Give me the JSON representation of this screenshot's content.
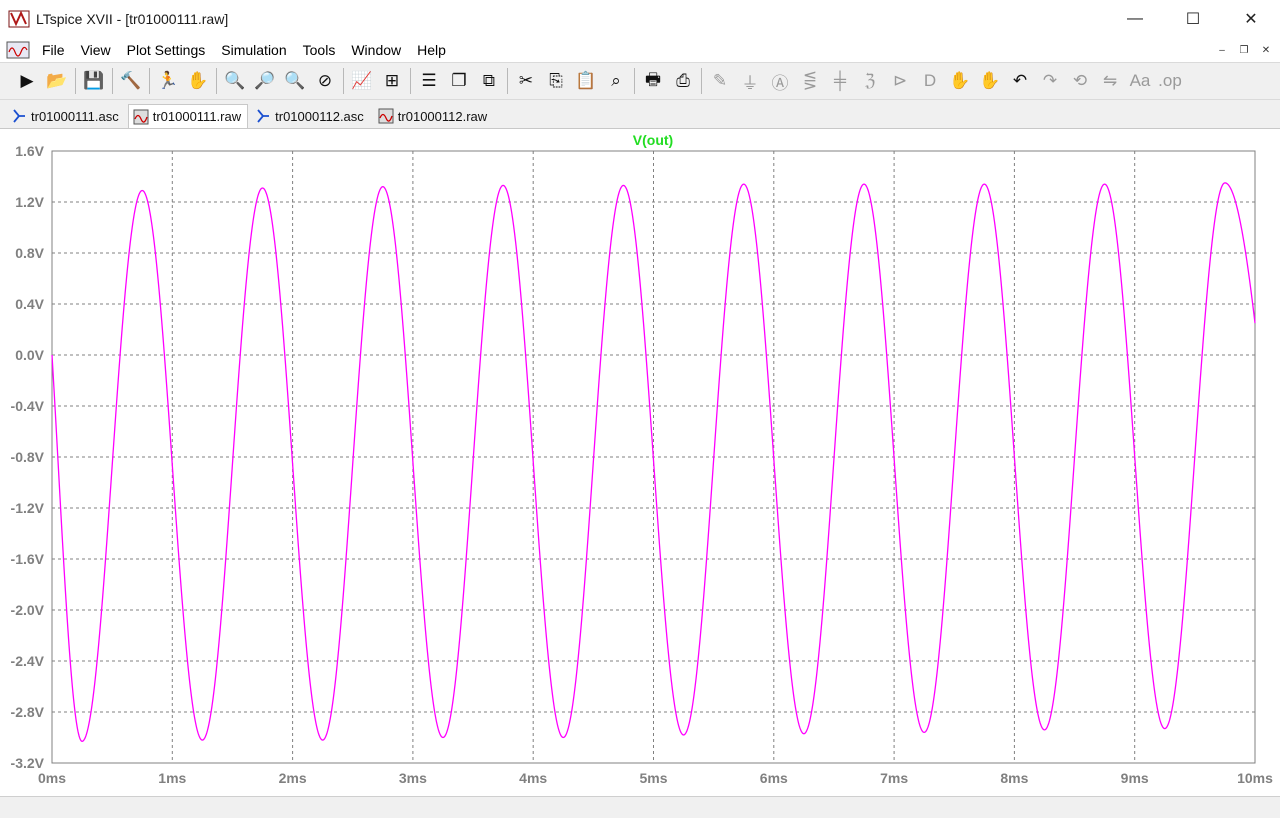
{
  "window": {
    "title": "LTspice XVII - [tr01000111.raw]",
    "minimize_glyph": "—",
    "maximize_glyph": "☐",
    "close_glyph": "✕"
  },
  "menu": {
    "items": [
      "File",
      "View",
      "Plot Settings",
      "Simulation",
      "Tools",
      "Window",
      "Help"
    ],
    "mdi_minimize": "–",
    "mdi_restore": "❐",
    "mdi_close": "✕"
  },
  "toolbar": {
    "groups": [
      [
        {
          "icon": "run-icon",
          "glyph": "▶"
        },
        {
          "icon": "open-icon",
          "glyph": "📂"
        }
      ],
      [
        {
          "icon": "save-icon",
          "glyph": "💾"
        }
      ],
      [
        {
          "icon": "control-panel-icon",
          "glyph": "🔨"
        }
      ],
      [
        {
          "icon": "run-simulation-icon",
          "glyph": "🏃"
        },
        {
          "icon": "halt-icon",
          "glyph": "✋",
          "dim": true
        }
      ],
      [
        {
          "icon": "zoom-in-icon",
          "glyph": "🔍"
        },
        {
          "icon": "zoom-full-icon",
          "glyph": "🔎"
        },
        {
          "icon": "zoom-out-icon",
          "glyph": "🔍"
        },
        {
          "icon": "zoom-cancel-icon",
          "glyph": "⊘"
        }
      ],
      [
        {
          "icon": "autorange-icon",
          "glyph": "📈"
        },
        {
          "icon": "mark-icon",
          "glyph": "⊞"
        }
      ],
      [
        {
          "icon": "tile-horizontal-icon",
          "glyph": "☰"
        },
        {
          "icon": "cascade-icon",
          "glyph": "❐"
        },
        {
          "icon": "tile-vertical-icon",
          "glyph": "⧉"
        }
      ],
      [
        {
          "icon": "cut-icon",
          "glyph": "✂"
        },
        {
          "icon": "copy-icon",
          "glyph": "⎘"
        },
        {
          "icon": "paste-icon",
          "glyph": "📋"
        },
        {
          "icon": "find-icon",
          "glyph": "⌕"
        }
      ],
      [
        {
          "icon": "print-icon",
          "glyph": "🖶"
        },
        {
          "icon": "print-preview-icon",
          "glyph": "⎙"
        }
      ],
      [
        {
          "icon": "wire-icon",
          "glyph": "✎",
          "dim": true
        },
        {
          "icon": "ground-icon",
          "glyph": "⏚",
          "dim": true
        },
        {
          "icon": "label-icon",
          "glyph": "Ⓐ",
          "dim": true
        },
        {
          "icon": "resistor-icon",
          "glyph": "⋚",
          "dim": true
        },
        {
          "icon": "capacitor-icon",
          "glyph": "╪",
          "dim": true
        },
        {
          "icon": "inductor-icon",
          "glyph": "ℨ",
          "dim": true
        },
        {
          "icon": "diode-icon",
          "glyph": "⊳",
          "dim": true
        },
        {
          "icon": "component-icon",
          "glyph": "D",
          "dim": true
        },
        {
          "icon": "move-icon",
          "glyph": "✋",
          "dim": true
        },
        {
          "icon": "drag-icon",
          "glyph": "✋",
          "dim": true
        },
        {
          "icon": "undo-icon",
          "glyph": "↶"
        },
        {
          "icon": "redo-icon",
          "glyph": "↷",
          "dim": true
        },
        {
          "icon": "rotate-icon",
          "glyph": "⟲",
          "dim": true
        },
        {
          "icon": "mirror-icon",
          "glyph": "⇋",
          "dim": true
        },
        {
          "icon": "text-icon",
          "glyph": "Aa",
          "dim": true
        },
        {
          "icon": "spice-directive-icon",
          "glyph": ".op",
          "dim": true
        }
      ]
    ]
  },
  "tabs": [
    {
      "label": "tr01000111.asc",
      "kind": "schematic",
      "active": false
    },
    {
      "label": "tr01000111.raw",
      "kind": "waveform",
      "active": true
    },
    {
      "label": "tr01000112.asc",
      "kind": "schematic",
      "active": false
    },
    {
      "label": "tr01000112.raw",
      "kind": "waveform",
      "active": false
    }
  ],
  "colors": {
    "trace": "#ff00ff",
    "trace_label": "#22dd22",
    "grid": "#808080",
    "axis_text": "#808080",
    "plot_bg": "#ffffff"
  },
  "chart_data": {
    "type": "line",
    "title": "V(out)",
    "xlabel": "",
    "ylabel": "",
    "xlim": [
      0,
      10
    ],
    "ylim": [
      -3.2,
      1.6
    ],
    "x_unit": "ms",
    "y_unit": "V",
    "x_ticks": [
      "0ms",
      "1ms",
      "2ms",
      "3ms",
      "4ms",
      "5ms",
      "6ms",
      "7ms",
      "8ms",
      "9ms",
      "10ms"
    ],
    "y_ticks": [
      "1.6V",
      "1.2V",
      "0.8V",
      "0.4V",
      "0.0V",
      "-0.4V",
      "-0.8V",
      "-1.2V",
      "-1.6V",
      "-2.0V",
      "-2.4V",
      "-2.8V",
      "-3.2V"
    ],
    "grid": true,
    "series": [
      {
        "name": "V(out)",
        "frequency_hz": 1000,
        "start_value": 0.0,
        "peaks": [
          {
            "t": 0.75,
            "v": 1.29
          },
          {
            "t": 1.75,
            "v": 1.31
          },
          {
            "t": 2.75,
            "v": 1.32
          },
          {
            "t": 3.75,
            "v": 1.33
          },
          {
            "t": 4.75,
            "v": 1.33
          },
          {
            "t": 5.75,
            "v": 1.34
          },
          {
            "t": 6.75,
            "v": 1.34
          },
          {
            "t": 7.75,
            "v": 1.34
          },
          {
            "t": 8.75,
            "v": 1.34
          },
          {
            "t": 9.75,
            "v": 1.35
          }
        ],
        "troughs": [
          {
            "t": 0.25,
            "v": -3.03
          },
          {
            "t": 1.25,
            "v": -3.02
          },
          {
            "t": 2.25,
            "v": -3.02
          },
          {
            "t": 3.25,
            "v": -3.0
          },
          {
            "t": 4.25,
            "v": -3.0
          },
          {
            "t": 5.25,
            "v": -2.98
          },
          {
            "t": 6.25,
            "v": -2.97
          },
          {
            "t": 7.25,
            "v": -2.96
          },
          {
            "t": 8.25,
            "v": -2.94
          },
          {
            "t": 9.25,
            "v": -2.93
          }
        ],
        "end_value": 0.25
      }
    ]
  }
}
